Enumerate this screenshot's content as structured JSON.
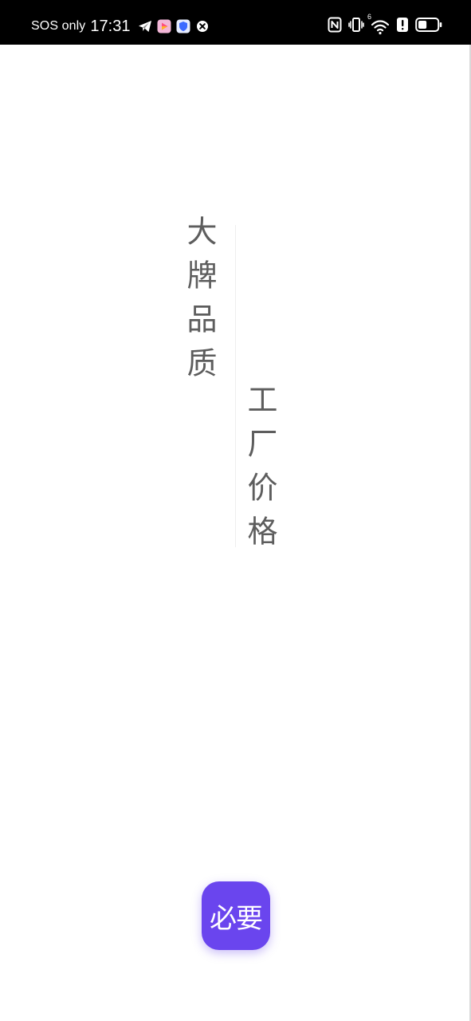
{
  "status_bar": {
    "carrier": "SOS only",
    "time": "17:31",
    "left_icons": [
      "telegram-icon",
      "video-app-icon",
      "shield-app-icon",
      "close-circle-icon"
    ],
    "right_icons": [
      "nfc-icon",
      "vibrate-icon",
      "wifi-6-icon",
      "alert-icon",
      "battery-icon"
    ],
    "wifi_label": "6",
    "battery_level": 0.45
  },
  "splash": {
    "slogan_left": "大牌品质",
    "slogan_right": "工厂价格",
    "logo_text": "必要",
    "accent_color": "#6a45ee"
  }
}
